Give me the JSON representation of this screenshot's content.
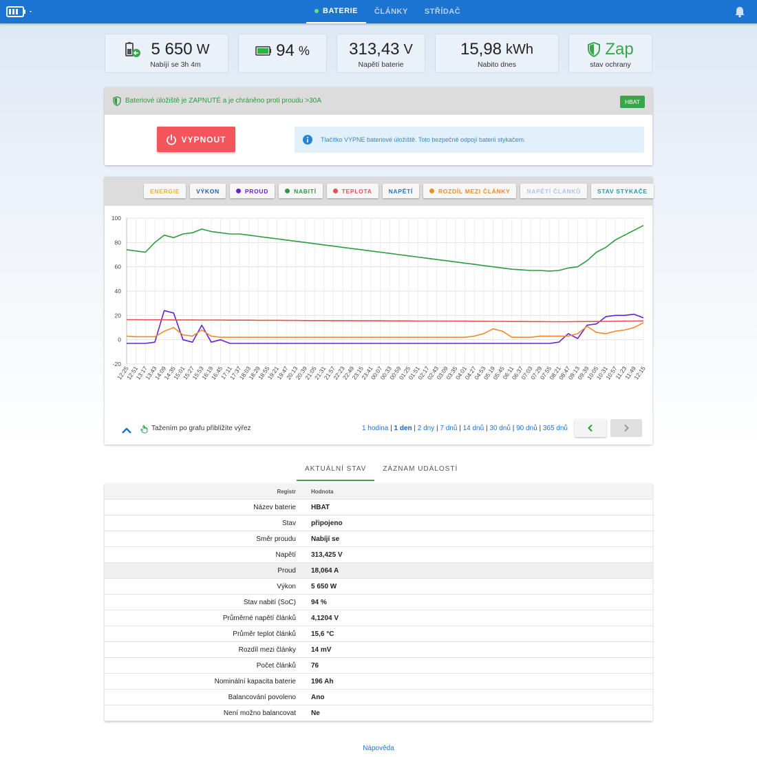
{
  "nav": {
    "items": [
      "BATERIE",
      "ČLÁNKY",
      "STŘÍDAČ"
    ]
  },
  "stats": {
    "power": {
      "value": "5 650",
      "unit": "W",
      "sub": "Nabíjí se 3h 4m"
    },
    "soc": {
      "value": "94",
      "unit": "%"
    },
    "voltage": {
      "value": "313,43",
      "unit": "V",
      "sub": "Napětí baterie"
    },
    "energy": {
      "value": "15,98",
      "unit": "kWh",
      "sub": "Nabito dnes"
    },
    "protection": {
      "value": "Zap",
      "sub": "stav ochrany"
    }
  },
  "protection_card": {
    "text": "Bateriové úložiště je ZAPNUTÉ a je chráněno proti proudu >30A",
    "badge": "HBAT",
    "off_button": "VYPNOUT",
    "info": "Tlačítko VYPNE bateriové úložiště. Toto bezpečně odpojí baterii stykačem."
  },
  "filters": [
    {
      "label": "ENERGIE",
      "color": "#e8b32a",
      "dot": false,
      "bold": false
    },
    {
      "label": "VÝKON",
      "color": "#1b5fae",
      "dot": false,
      "bold": true
    },
    {
      "label": "PROUD",
      "color": "#6a1fd6",
      "dot": true,
      "bold": true
    },
    {
      "label": "NABITÍ",
      "color": "#2d9a3e",
      "dot": true,
      "bold": true
    },
    {
      "label": "TEPLOTA",
      "color": "#ea4f4f",
      "dot": true,
      "bold": true
    },
    {
      "label": "NAPĚTÍ",
      "color": "#1b73d2",
      "dot": false,
      "bold": true
    },
    {
      "label": "ROZDÍL MEZI ČLÁNKY",
      "color": "#f08a2a",
      "dot": true,
      "bold": false
    },
    {
      "label": "NAPĚTÍ ČLÁNKŮ",
      "color": "#a9c6ea",
      "dot": false,
      "bold": false
    },
    {
      "label": "STAV STYKAČE",
      "color": "#1a9bb0",
      "dot": false,
      "bold": true
    }
  ],
  "chart_data": {
    "type": "line",
    "ylim": [
      -20,
      100
    ],
    "yticks": [
      -20,
      0,
      20,
      40,
      60,
      80,
      100
    ],
    "grid": true,
    "x": [
      "12:25",
      "12:51",
      "13:17",
      "13:43",
      "14:09",
      "14:35",
      "15:01",
      "15:27",
      "15:53",
      "16:19",
      "16:45",
      "17:11",
      "17:37",
      "18:03",
      "18:29",
      "18:55",
      "19:21",
      "19:47",
      "20:13",
      "20:39",
      "21:05",
      "21:31",
      "21:57",
      "22:23",
      "22:49",
      "23:15",
      "23:41",
      "00:07",
      "00:33",
      "00:59",
      "01:25",
      "01:51",
      "02:17",
      "02:43",
      "03:09",
      "03:35",
      "04:01",
      "04:27",
      "04:53",
      "05:19",
      "05:45",
      "06:11",
      "06:37",
      "07:03",
      "07:29",
      "07:55",
      "08:21",
      "08:47",
      "09:13",
      "09:39",
      "10:05",
      "10:31",
      "10:57",
      "11:23",
      "11:49",
      "12:15"
    ],
    "series": [
      {
        "color": "#2d9a3e",
        "values": [
          74,
          73,
          72,
          80,
          86,
          84,
          87,
          88,
          91,
          89,
          88,
          87,
          87,
          86,
          85,
          84,
          83,
          82,
          81,
          80,
          79,
          78,
          77,
          76,
          75,
          74,
          73,
          72,
          71,
          70,
          69,
          68,
          67,
          66,
          65,
          64,
          63,
          62,
          61,
          60,
          59,
          58,
          57.5,
          57,
          57,
          56.5,
          57,
          59,
          60,
          65,
          72,
          76,
          82,
          86,
          90,
          94
        ]
      },
      {
        "color": "#6a1fd6",
        "values": [
          -3,
          -3,
          -3,
          -2,
          24,
          22,
          0,
          -2,
          12,
          -2,
          0,
          -3,
          -3,
          -3,
          -3,
          -3,
          -3,
          -3,
          -3,
          -3,
          -3,
          -3,
          -3,
          -3,
          -3,
          -3,
          -3,
          -3,
          -3,
          -3,
          -3,
          -3,
          -3,
          -3,
          -3,
          -3,
          -3,
          -3,
          -3,
          -3,
          -3,
          -3,
          -3,
          -3,
          -3,
          -3,
          -2,
          5,
          1,
          12,
          13,
          19,
          20,
          20,
          21,
          18
        ]
      },
      {
        "color": "#ea4f4f",
        "values": [
          16.5,
          16.5,
          16.4,
          16.4,
          16.4,
          16.3,
          16.3,
          16.3,
          16.2,
          16.2,
          16.2,
          16.1,
          16.1,
          16.1,
          16,
          16,
          16,
          15.9,
          15.9,
          15.8,
          15.8,
          15.8,
          15.7,
          15.7,
          15.7,
          15.6,
          15.6,
          15.6,
          15.5,
          15.5,
          15.5,
          15.4,
          15.4,
          15.4,
          15.3,
          15.3,
          15.3,
          15.2,
          15.2,
          15.1,
          15.1,
          15,
          15,
          14.9,
          14.9,
          14.8,
          14.8,
          14.8,
          14.9,
          15,
          15,
          15.1,
          15.2,
          15.3,
          15.4,
          15.5
        ]
      },
      {
        "color": "#f08a2a",
        "values": [
          3,
          2.5,
          2.5,
          2.5,
          7,
          10,
          4,
          3,
          8,
          3,
          2,
          2,
          2,
          2,
          2,
          2,
          2,
          2,
          2,
          2,
          2,
          2,
          2,
          2,
          2,
          2,
          2,
          2,
          2,
          2,
          2,
          2,
          2,
          2,
          2,
          2,
          2,
          3,
          5,
          9,
          7,
          2,
          2,
          2,
          3,
          3,
          3,
          3,
          5,
          11,
          6,
          5,
          7,
          8,
          10,
          14
        ]
      }
    ]
  },
  "chart_footer": {
    "zoom_hint": "Tažením po grafu přiblížíte výřez",
    "ranges": [
      "1 hodina",
      "1 den",
      "2 dny",
      "7 dnů",
      "14 dnů",
      "30 dnů",
      "90 dnů",
      "365 dnů"
    ],
    "active_range": "1 den"
  },
  "tabs": [
    "AKTUÁLNÍ STAV",
    "ZÁZNAM UDÁLOSTÍ"
  ],
  "table": {
    "head": {
      "k": "Registr",
      "v": "Hodnota"
    },
    "rows": [
      {
        "k": "Název baterie",
        "v": "HBAT"
      },
      {
        "k": "Stav",
        "v": "připojeno"
      },
      {
        "k": "Směr proudu",
        "v": "Nabíjí se"
      },
      {
        "k": "Napětí",
        "v": "313,425 V"
      },
      {
        "k": "Proud",
        "v": "18,064 A"
      },
      {
        "k": "Výkon",
        "v": "5 650 W"
      },
      {
        "k": "Stav nabití (SoC)",
        "v": "94 %"
      },
      {
        "k": "Průměrné napětí článků",
        "v": "4,1204 V"
      },
      {
        "k": "Průměr teplot článků",
        "v": "15,6 °C"
      },
      {
        "k": "Rozdíl mezi články",
        "v": "14 mV"
      },
      {
        "k": "Počet článků",
        "v": "76"
      },
      {
        "k": "Nominální kapacita baterie",
        "v": "196 Ah"
      },
      {
        "k": "Balancování povoleno",
        "v": "Ano"
      },
      {
        "k": "Není možno balancovat",
        "v": "Ne"
      }
    ]
  },
  "help_link": "Nápověda"
}
